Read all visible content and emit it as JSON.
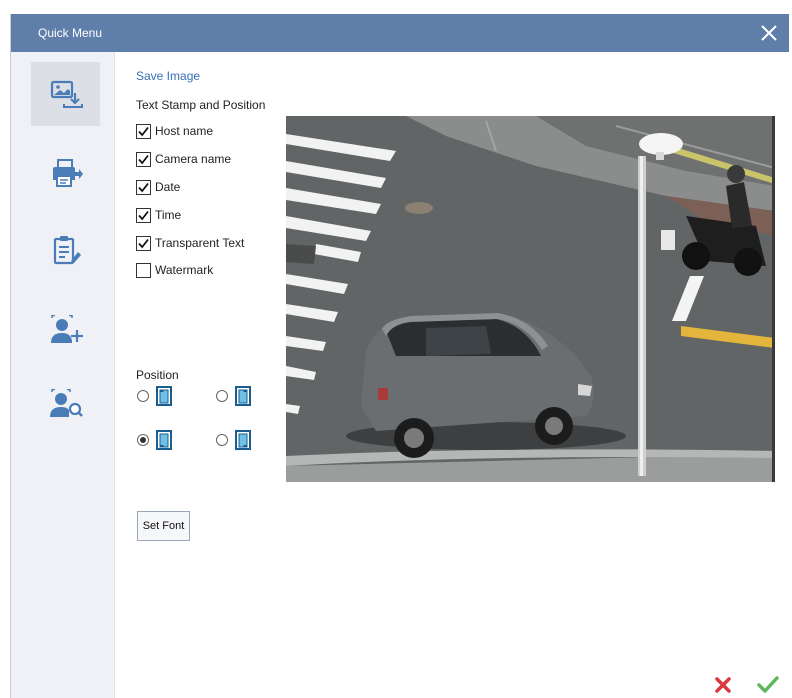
{
  "window": {
    "title": "Quick Menu"
  },
  "sidebar": {
    "items": [
      {
        "icon": "save-image-icon",
        "active": true
      },
      {
        "icon": "printer-icon",
        "active": false
      },
      {
        "icon": "clipboard-edit-icon",
        "active": false
      },
      {
        "icon": "add-person-icon",
        "active": false
      },
      {
        "icon": "search-person-icon",
        "active": false
      }
    ]
  },
  "main": {
    "heading": "Save Image",
    "stamp_section": "Text Stamp and Position",
    "options": [
      {
        "label": "Host name",
        "checked": true
      },
      {
        "label": "Camera name",
        "checked": true
      },
      {
        "label": "Date",
        "checked": true
      },
      {
        "label": "Time",
        "checked": true
      },
      {
        "label": "Transparent Text",
        "checked": true
      },
      {
        "label": "Watermark",
        "checked": false
      }
    ],
    "position_label": "Position",
    "positions": [
      {
        "id": "top-left",
        "selected": false
      },
      {
        "id": "top-right",
        "selected": false
      },
      {
        "id": "bottom-left",
        "selected": true
      },
      {
        "id": "bottom-right",
        "selected": false
      }
    ],
    "set_font_label": "Set Font"
  },
  "colors": {
    "title_bar": "#5f7ea9",
    "sidebar_bg": "#eff1f6",
    "link": "#3b6fb8",
    "icon_blue": "#4a7db8",
    "cancel_red": "#d9393e",
    "ok_green": "#5cb85c"
  }
}
